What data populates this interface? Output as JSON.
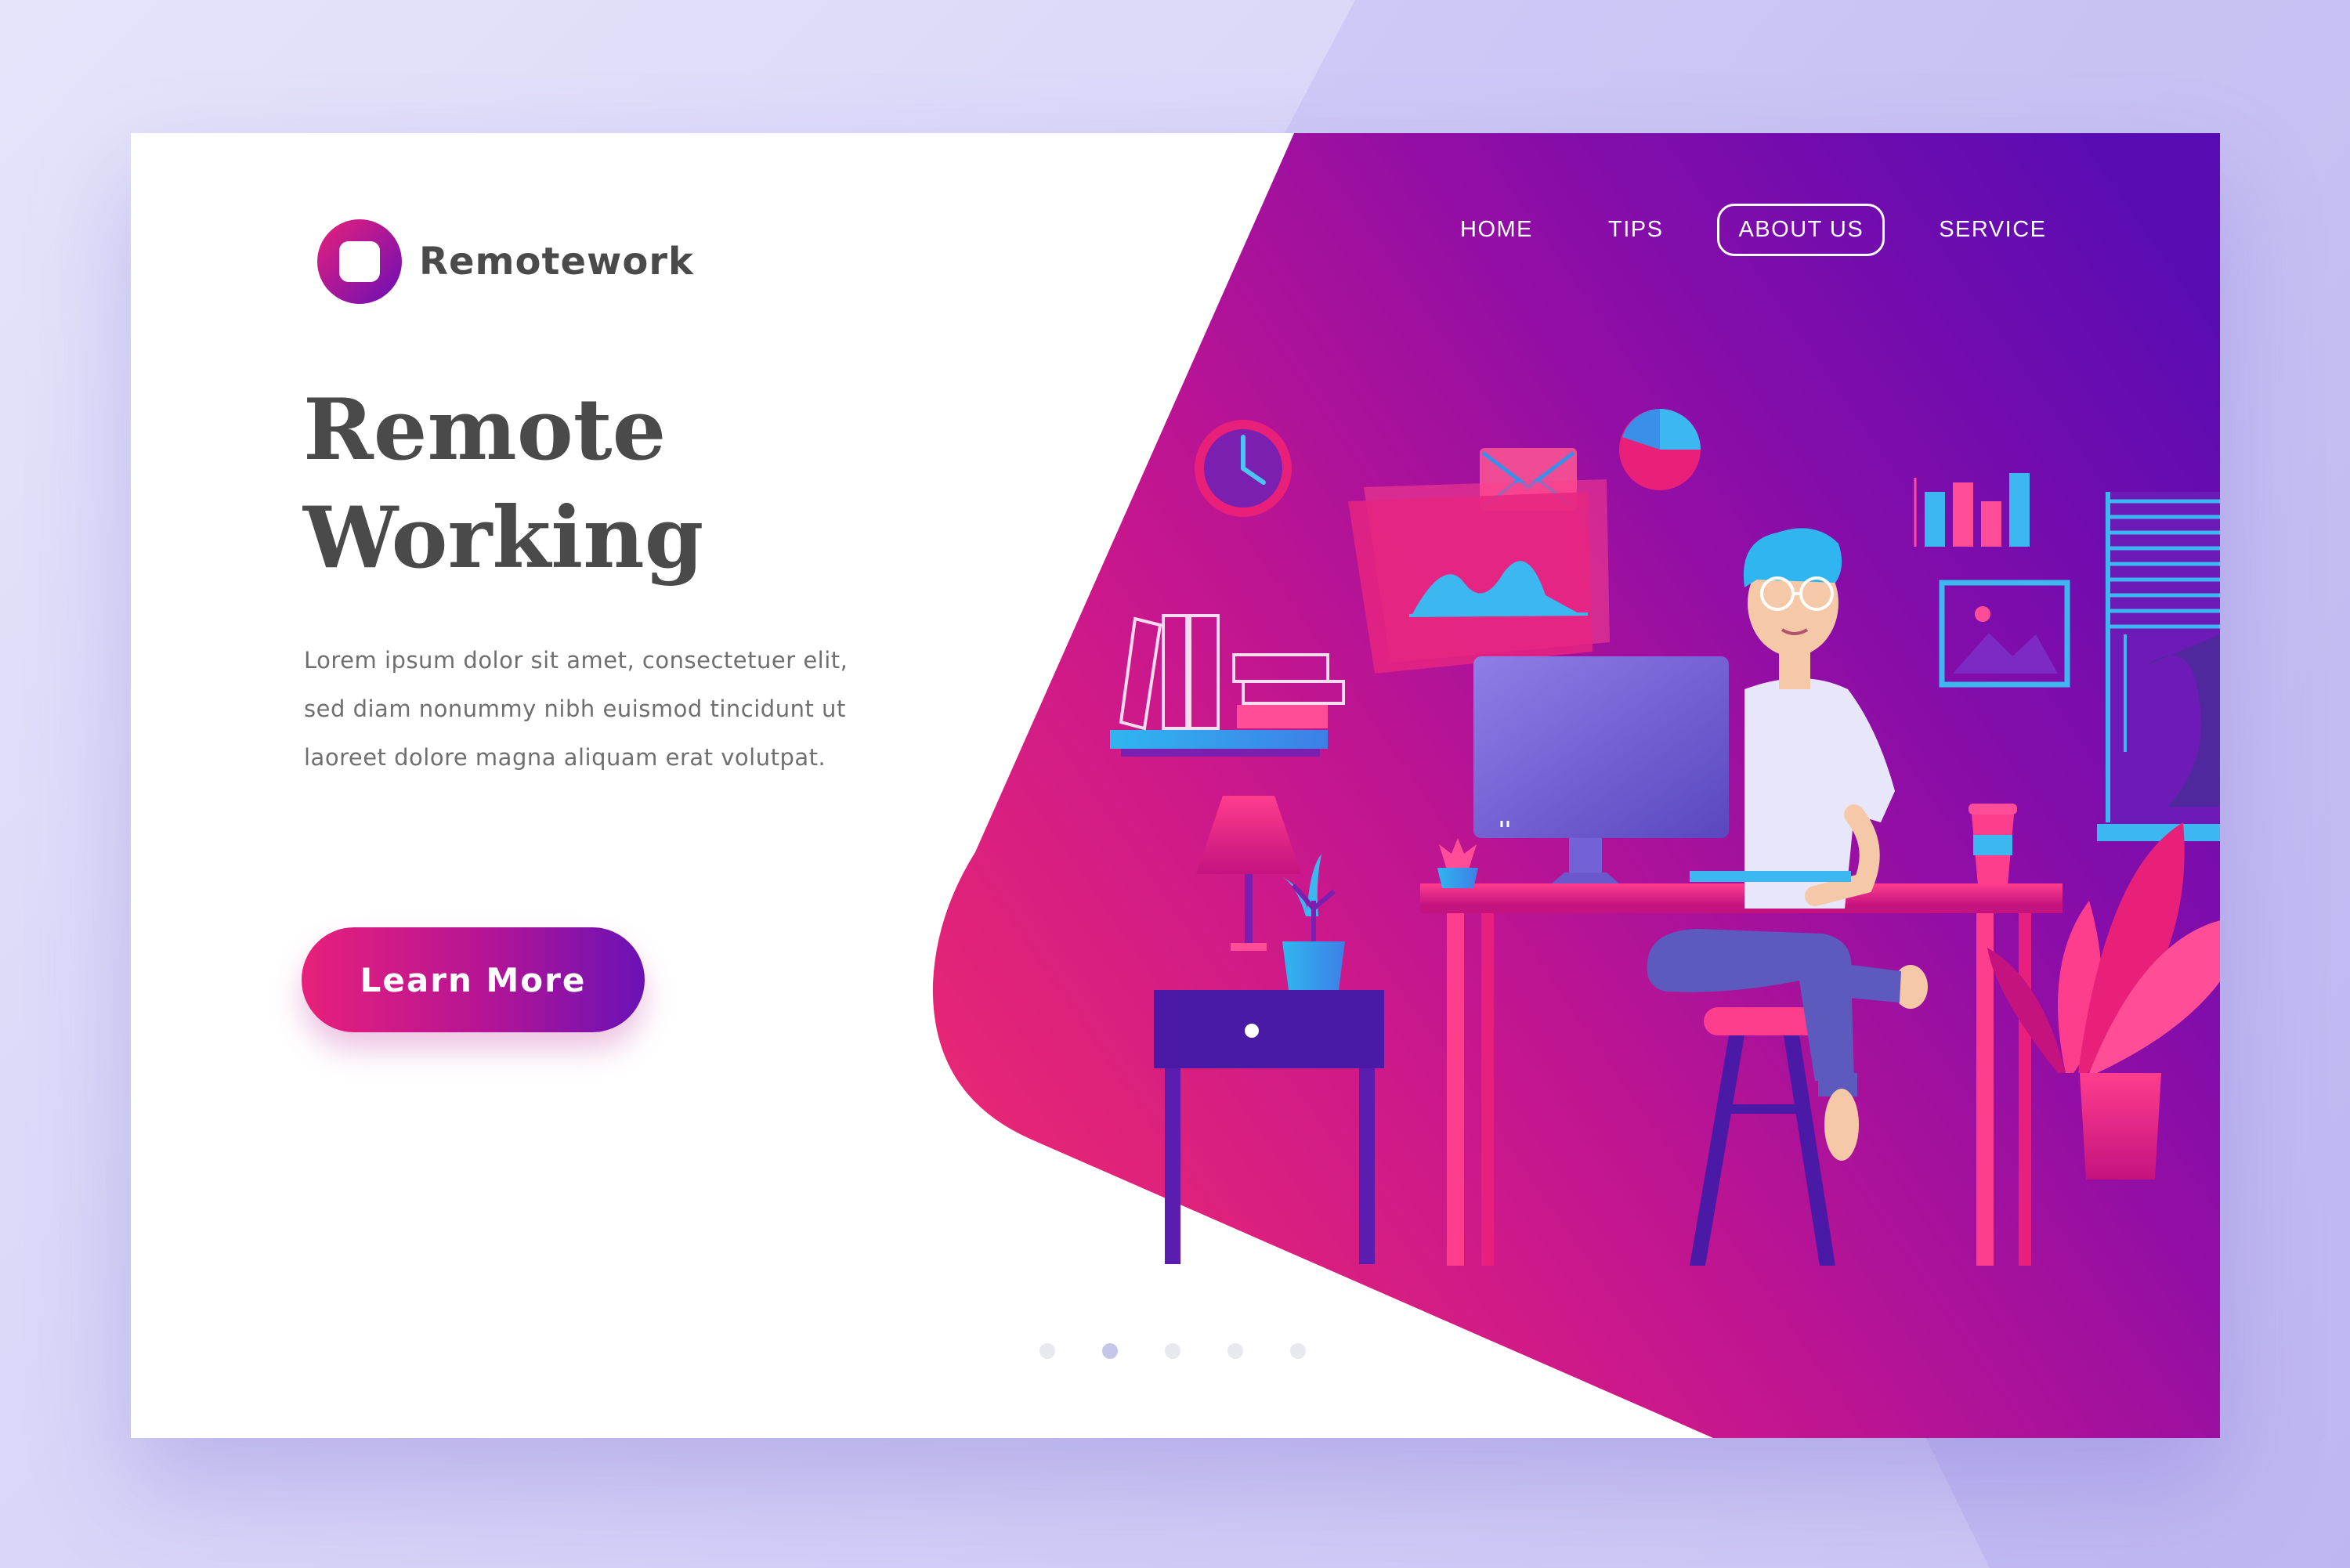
{
  "brand": {
    "name": "Remotework"
  },
  "nav": {
    "items": [
      {
        "label": "HOME",
        "active": false
      },
      {
        "label": "TIPS",
        "active": false
      },
      {
        "label": "ABOUT US",
        "active": true
      },
      {
        "label": "SERVICE",
        "active": false
      }
    ]
  },
  "hero": {
    "title_line1": "Remote",
    "title_line2": "Working",
    "body_lines": [
      "Lorem ipsum dolor sit amet, consectetuer  elit,",
      "sed diam nonummy nibh euismod tincidunt ut",
      "laoreet dolore magna aliquam erat volutpat."
    ],
    "cta_label": "Learn More"
  },
  "pagination": {
    "count": 5,
    "active_index": 1
  },
  "colors": {
    "accent_pink": "#e8207a",
    "accent_purple": "#6a0fb6",
    "accent_cyan": "#2fb6f0",
    "text_dark": "#4a4a4a",
    "text_body": "#6f6f6f"
  },
  "icons": [
    "clock-icon",
    "mail-icon",
    "pie-chart-icon",
    "bar-chart-icon",
    "picture-frame-icon",
    "area-chart-icon"
  ]
}
